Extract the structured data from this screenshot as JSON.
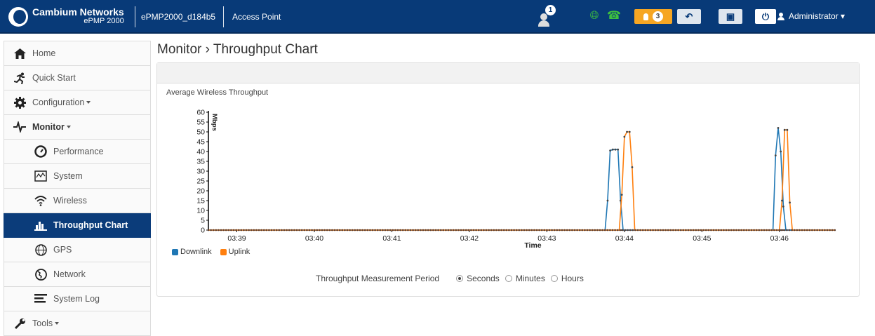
{
  "header": {
    "brand_name": "Cambium Networks",
    "brand_model": "ePMP 2000",
    "device_name": "ePMP2000_d184b5",
    "device_mode": "Access Point",
    "notification_count": "1",
    "alarm_count": "3",
    "user_label": "Administrator ▾",
    "colors": {
      "bar": "#083a78",
      "alarm": "#f6a623",
      "status_green": "#3ec13e"
    }
  },
  "sidebar": {
    "items": [
      {
        "label": "Home",
        "icon": "home-icon"
      },
      {
        "label": "Quick Start",
        "icon": "running-icon"
      },
      {
        "label": "Configuration",
        "icon": "gear-icon"
      },
      {
        "label": "Monitor",
        "icon": "pulse-icon"
      },
      {
        "label": "Performance",
        "icon": "gauge-icon"
      },
      {
        "label": "System",
        "icon": "system-chart-icon"
      },
      {
        "label": "Wireless",
        "icon": "wifi-icon"
      },
      {
        "label": "Throughput Chart",
        "icon": "bar-chart-icon"
      },
      {
        "label": "GPS",
        "icon": "gps-icon"
      },
      {
        "label": "Network",
        "icon": "globe-icon"
      },
      {
        "label": "System Log",
        "icon": "log-lines-icon"
      },
      {
        "label": "Tools",
        "icon": "wrench-icon"
      }
    ],
    "active": "Throughput Chart",
    "active_color": "#0b3c7a"
  },
  "page": {
    "title": "Monitor › Throughput Chart"
  },
  "chart": {
    "heading": "Average Wireless Throughput",
    "legend": [
      {
        "label": "Downlink",
        "color": "#1f77b4"
      },
      {
        "label": "Uplink",
        "color": "#ff7f0e"
      }
    ]
  },
  "chart_data": {
    "type": "line",
    "title": "Average Wireless Throughput",
    "xlabel": "Time",
    "ylabel": "Mbps",
    "ylim": [
      0,
      60
    ],
    "y_ticks": [
      0,
      5,
      10,
      15,
      20,
      25,
      30,
      35,
      40,
      45,
      50,
      55,
      60
    ],
    "x_ticks": [
      "03:39",
      "03:40",
      "03:41",
      "03:42",
      "03:43",
      "03:44",
      "03:45",
      "03:46"
    ],
    "xlim": [
      "03:38:38",
      "03:46:43"
    ],
    "grid": false,
    "legend_position": "bottom-left",
    "series": [
      {
        "name": "Downlink",
        "color": "#1f77b4",
        "points": [
          [
            "03:38:38",
            0
          ],
          [
            "03:43:45",
            0
          ],
          [
            "03:43:47",
            15
          ],
          [
            "03:43:49",
            40.5
          ],
          [
            "03:43:51",
            41
          ],
          [
            "03:43:53",
            41
          ],
          [
            "03:43:55",
            41
          ],
          [
            "03:43:57",
            15
          ],
          [
            "03:43:59",
            0
          ],
          [
            "03:45:55",
            0
          ],
          [
            "03:45:57",
            38
          ],
          [
            "03:45:59",
            52
          ],
          [
            "03:46:01",
            40
          ],
          [
            "03:46:03",
            12
          ],
          [
            "03:46:05",
            0
          ],
          [
            "03:46:43",
            0
          ]
        ]
      },
      {
        "name": "Uplink",
        "color": "#ff7f0e",
        "points": [
          [
            "03:38:38",
            0
          ],
          [
            "03:43:56",
            0
          ],
          [
            "03:43:58",
            18
          ],
          [
            "03:44:00",
            47.5
          ],
          [
            "03:44:02",
            50
          ],
          [
            "03:44:04",
            50
          ],
          [
            "03:44:06",
            32
          ],
          [
            "03:44:08",
            0
          ],
          [
            "03:46:00",
            0
          ],
          [
            "03:46:02",
            15
          ],
          [
            "03:46:04",
            51
          ],
          [
            "03:46:06",
            51
          ],
          [
            "03:46:08",
            14
          ],
          [
            "03:46:10",
            0
          ],
          [
            "03:46:43",
            0
          ]
        ]
      }
    ]
  },
  "period": {
    "label": "Throughput Measurement Period",
    "options": [
      "Seconds",
      "Minutes",
      "Hours"
    ],
    "selected": "Seconds"
  }
}
